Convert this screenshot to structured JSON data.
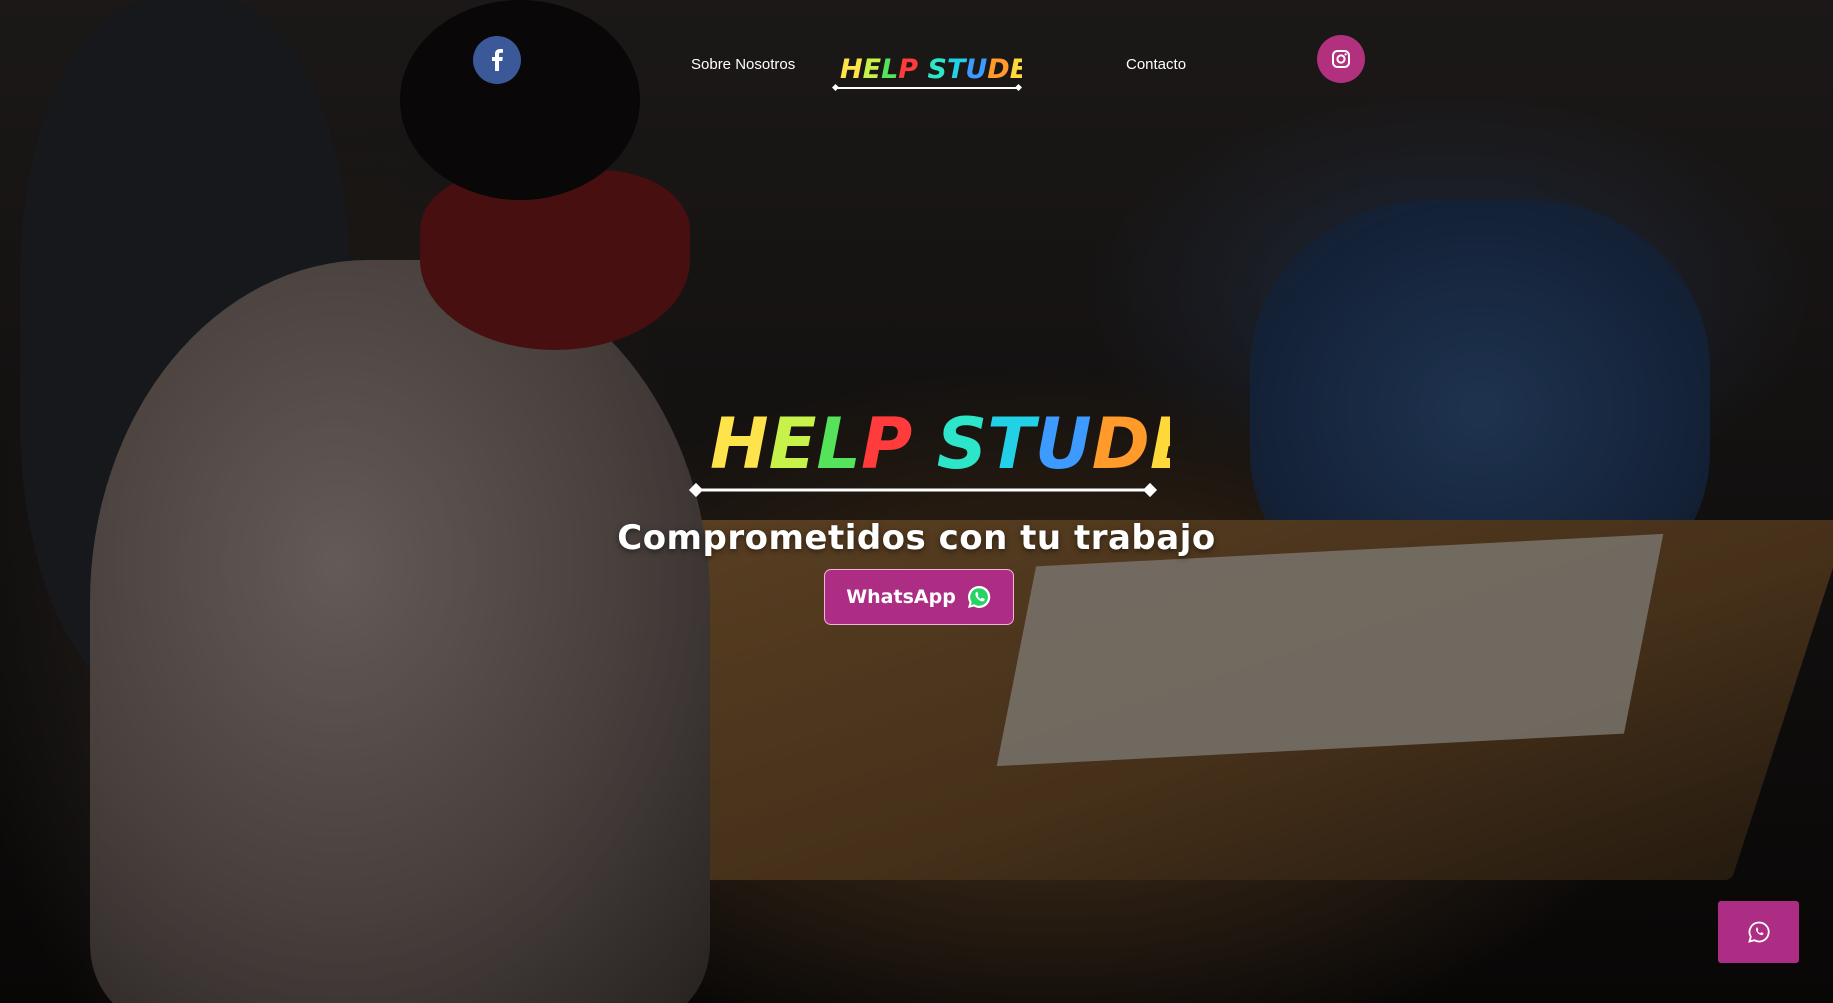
{
  "nav": {
    "about_label": "Sobre Nosotros",
    "contact_label": "Contacto",
    "facebook_icon": "facebook-icon",
    "instagram_icon": "instagram-icon"
  },
  "brand": {
    "word1": "HELP",
    "word2": "STUDENT",
    "letter_colors": [
      "#ffe34a",
      "#c6f24a",
      "#54e35a",
      "#ff3b3b",
      "#2de6c9",
      "#23d1e6",
      "#3d9bff",
      "#ff9a2b",
      "#ffd93a",
      "#37e27d",
      "#1fd6a0"
    ]
  },
  "hero": {
    "tagline": "Comprometidos con tu trabajo",
    "whatsapp_label": "WhatsApp"
  },
  "colors": {
    "accent": "#ae2d84",
    "facebook": "#3b5998",
    "instagram": "#b1317f"
  },
  "floating": {
    "icon": "whatsapp-icon"
  }
}
